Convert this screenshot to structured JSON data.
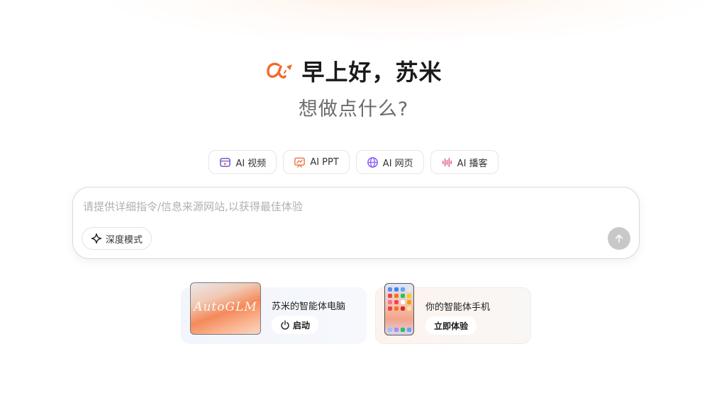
{
  "greeting": "早上好，苏米",
  "subtitle": "想做点什么?",
  "logo_icon": "alpha-rocket-logo",
  "colors": {
    "brand": "#f26a2a",
    "send_disabled": "#c8c8c8"
  },
  "chips": [
    {
      "label": "AI 视频",
      "icon": "video-icon",
      "color": "#6d5bd0"
    },
    {
      "label": "AI PPT",
      "icon": "ppt-icon",
      "color": "#f07a4a"
    },
    {
      "label": "AI 网页",
      "icon": "globe-icon",
      "color": "#8b5cf6"
    },
    {
      "label": "AI 播客",
      "icon": "audio-wave-icon",
      "color": "#e0588a"
    }
  ],
  "input": {
    "placeholder": "请提供详细指令/信息来源网站,以获得最佳体验",
    "value": ""
  },
  "deep_mode": {
    "label": "深度模式",
    "icon": "sparkle-icon"
  },
  "send": {
    "icon": "arrow-up-icon"
  },
  "cards": {
    "pc": {
      "title": "苏米的智能体电脑",
      "button": "启动",
      "button_icon": "power-icon",
      "thumb_text": "AutoGLM"
    },
    "phone": {
      "title": "你的智能体手机",
      "button": "立即体验"
    }
  }
}
